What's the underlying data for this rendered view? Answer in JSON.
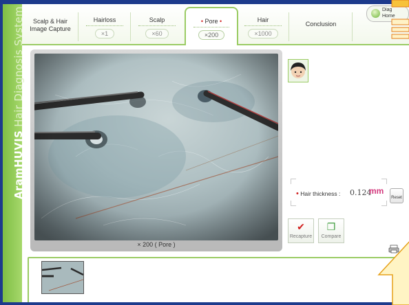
{
  "sidebar": {
    "brand": "AramHUVIS",
    "subtitle": "Hair Diagnosis System"
  },
  "tabs": [
    {
      "label": "Scalp & Hair",
      "label2": "Image Capture",
      "zoom": "",
      "active": false
    },
    {
      "label": "Hairloss",
      "zoom": "×1",
      "active": false
    },
    {
      "label": "Scalp",
      "zoom": "×60",
      "active": false
    },
    {
      "label": "Pore",
      "zoom": "×200",
      "active": true
    },
    {
      "label": "Hair",
      "zoom": "×1000",
      "active": false
    },
    {
      "label": "Conclusion",
      "zoom": "",
      "active": false
    }
  ],
  "diag_button": {
    "line1": "Diag",
    "line2": "Home"
  },
  "image": {
    "caption": "× 200 ( Pore )"
  },
  "measurement": {
    "label": "Hair thickness :",
    "value": "0.124",
    "unit": "mm",
    "reset_label": "Reset"
  },
  "actions": {
    "recapture": "Recapture",
    "compare": "Compare"
  },
  "icons": {
    "avatar": "face-avatar-icon",
    "recapture": "check-icon",
    "compare": "compare-icon",
    "print": "printer-icon"
  },
  "colors": {
    "accent": "#9acb63",
    "frame": "#1d3a8c",
    "unit": "#d33a7e",
    "marker": "#d02020"
  }
}
